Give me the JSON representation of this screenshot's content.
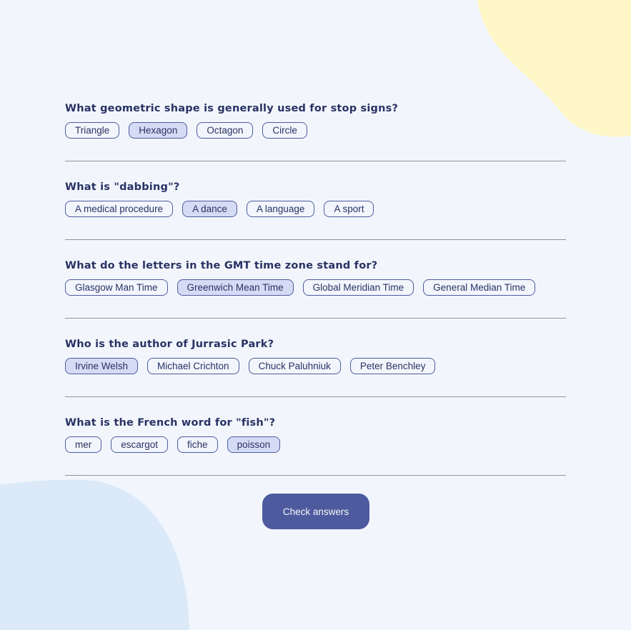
{
  "colors": {
    "background": "#f2f6fc",
    "text": "#293264",
    "accent": "#4d5b9e",
    "selected_answer": "#d6dbf5",
    "blob_top": "#fff7c7",
    "blob_bottom": "#dbe9f8"
  },
  "questions": [
    {
      "text": "What geometric shape is generally used for stop signs?",
      "answers": [
        "Triangle",
        "Hexagon",
        "Octagon",
        "Circle"
      ],
      "selected": "Hexagon"
    },
    {
      "text": "What is \"dabbing\"?",
      "answers": [
        "A medical procedure",
        "A dance",
        "A language",
        "A sport"
      ],
      "selected": "A dance"
    },
    {
      "text": "What do the letters in the GMT time zone stand for?",
      "answers": [
        "Glasgow Man Time",
        "Greenwich Mean Time",
        "Global Meridian Time",
        "General Median Time"
      ],
      "selected": "Greenwich Mean Time"
    },
    {
      "text": "Who is the author of Jurrasic Park?",
      "answers": [
        "Irvine Welsh",
        "Michael Crichton",
        "Chuck Paluhniuk",
        "Peter Benchley"
      ],
      "selected": "Irvine Welsh"
    },
    {
      "text": "What is the French word for \"fish\"?",
      "answers": [
        "mer",
        "escargot",
        "fiche",
        "poisson"
      ],
      "selected": "poisson"
    }
  ],
  "check_button": {
    "label": "Check answers"
  }
}
